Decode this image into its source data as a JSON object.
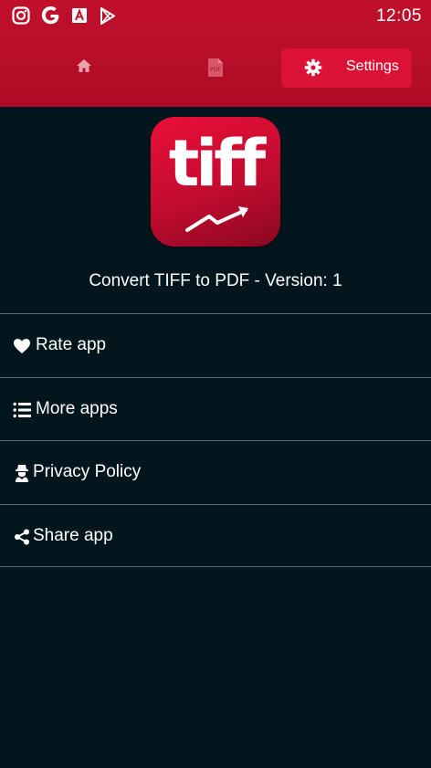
{
  "status_bar": {
    "time": "12:05",
    "icons": [
      "instagram-icon",
      "google-icon",
      "android-a-icon",
      "play-store-icon"
    ]
  },
  "nav": {
    "home_icon": "home-icon",
    "pdf_icon": "pdf-file-icon",
    "pdf_badge": "PDF",
    "settings_label": "Settings"
  },
  "logo": {
    "text": "tiff"
  },
  "app_title": "Convert TIFF to PDF - Version: 1",
  "menu": {
    "items": [
      {
        "label": "Rate app",
        "icon": "heart-icon"
      },
      {
        "label": "More apps",
        "icon": "list-icon"
      },
      {
        "label": "Privacy Policy",
        "icon": "user-secret-icon"
      },
      {
        "label": "Share app",
        "icon": "share-icon"
      }
    ]
  },
  "colors": {
    "header": "#c0102c",
    "active_tab": "#dc1136",
    "background": "#03161d",
    "divider": "#5a6a70"
  }
}
